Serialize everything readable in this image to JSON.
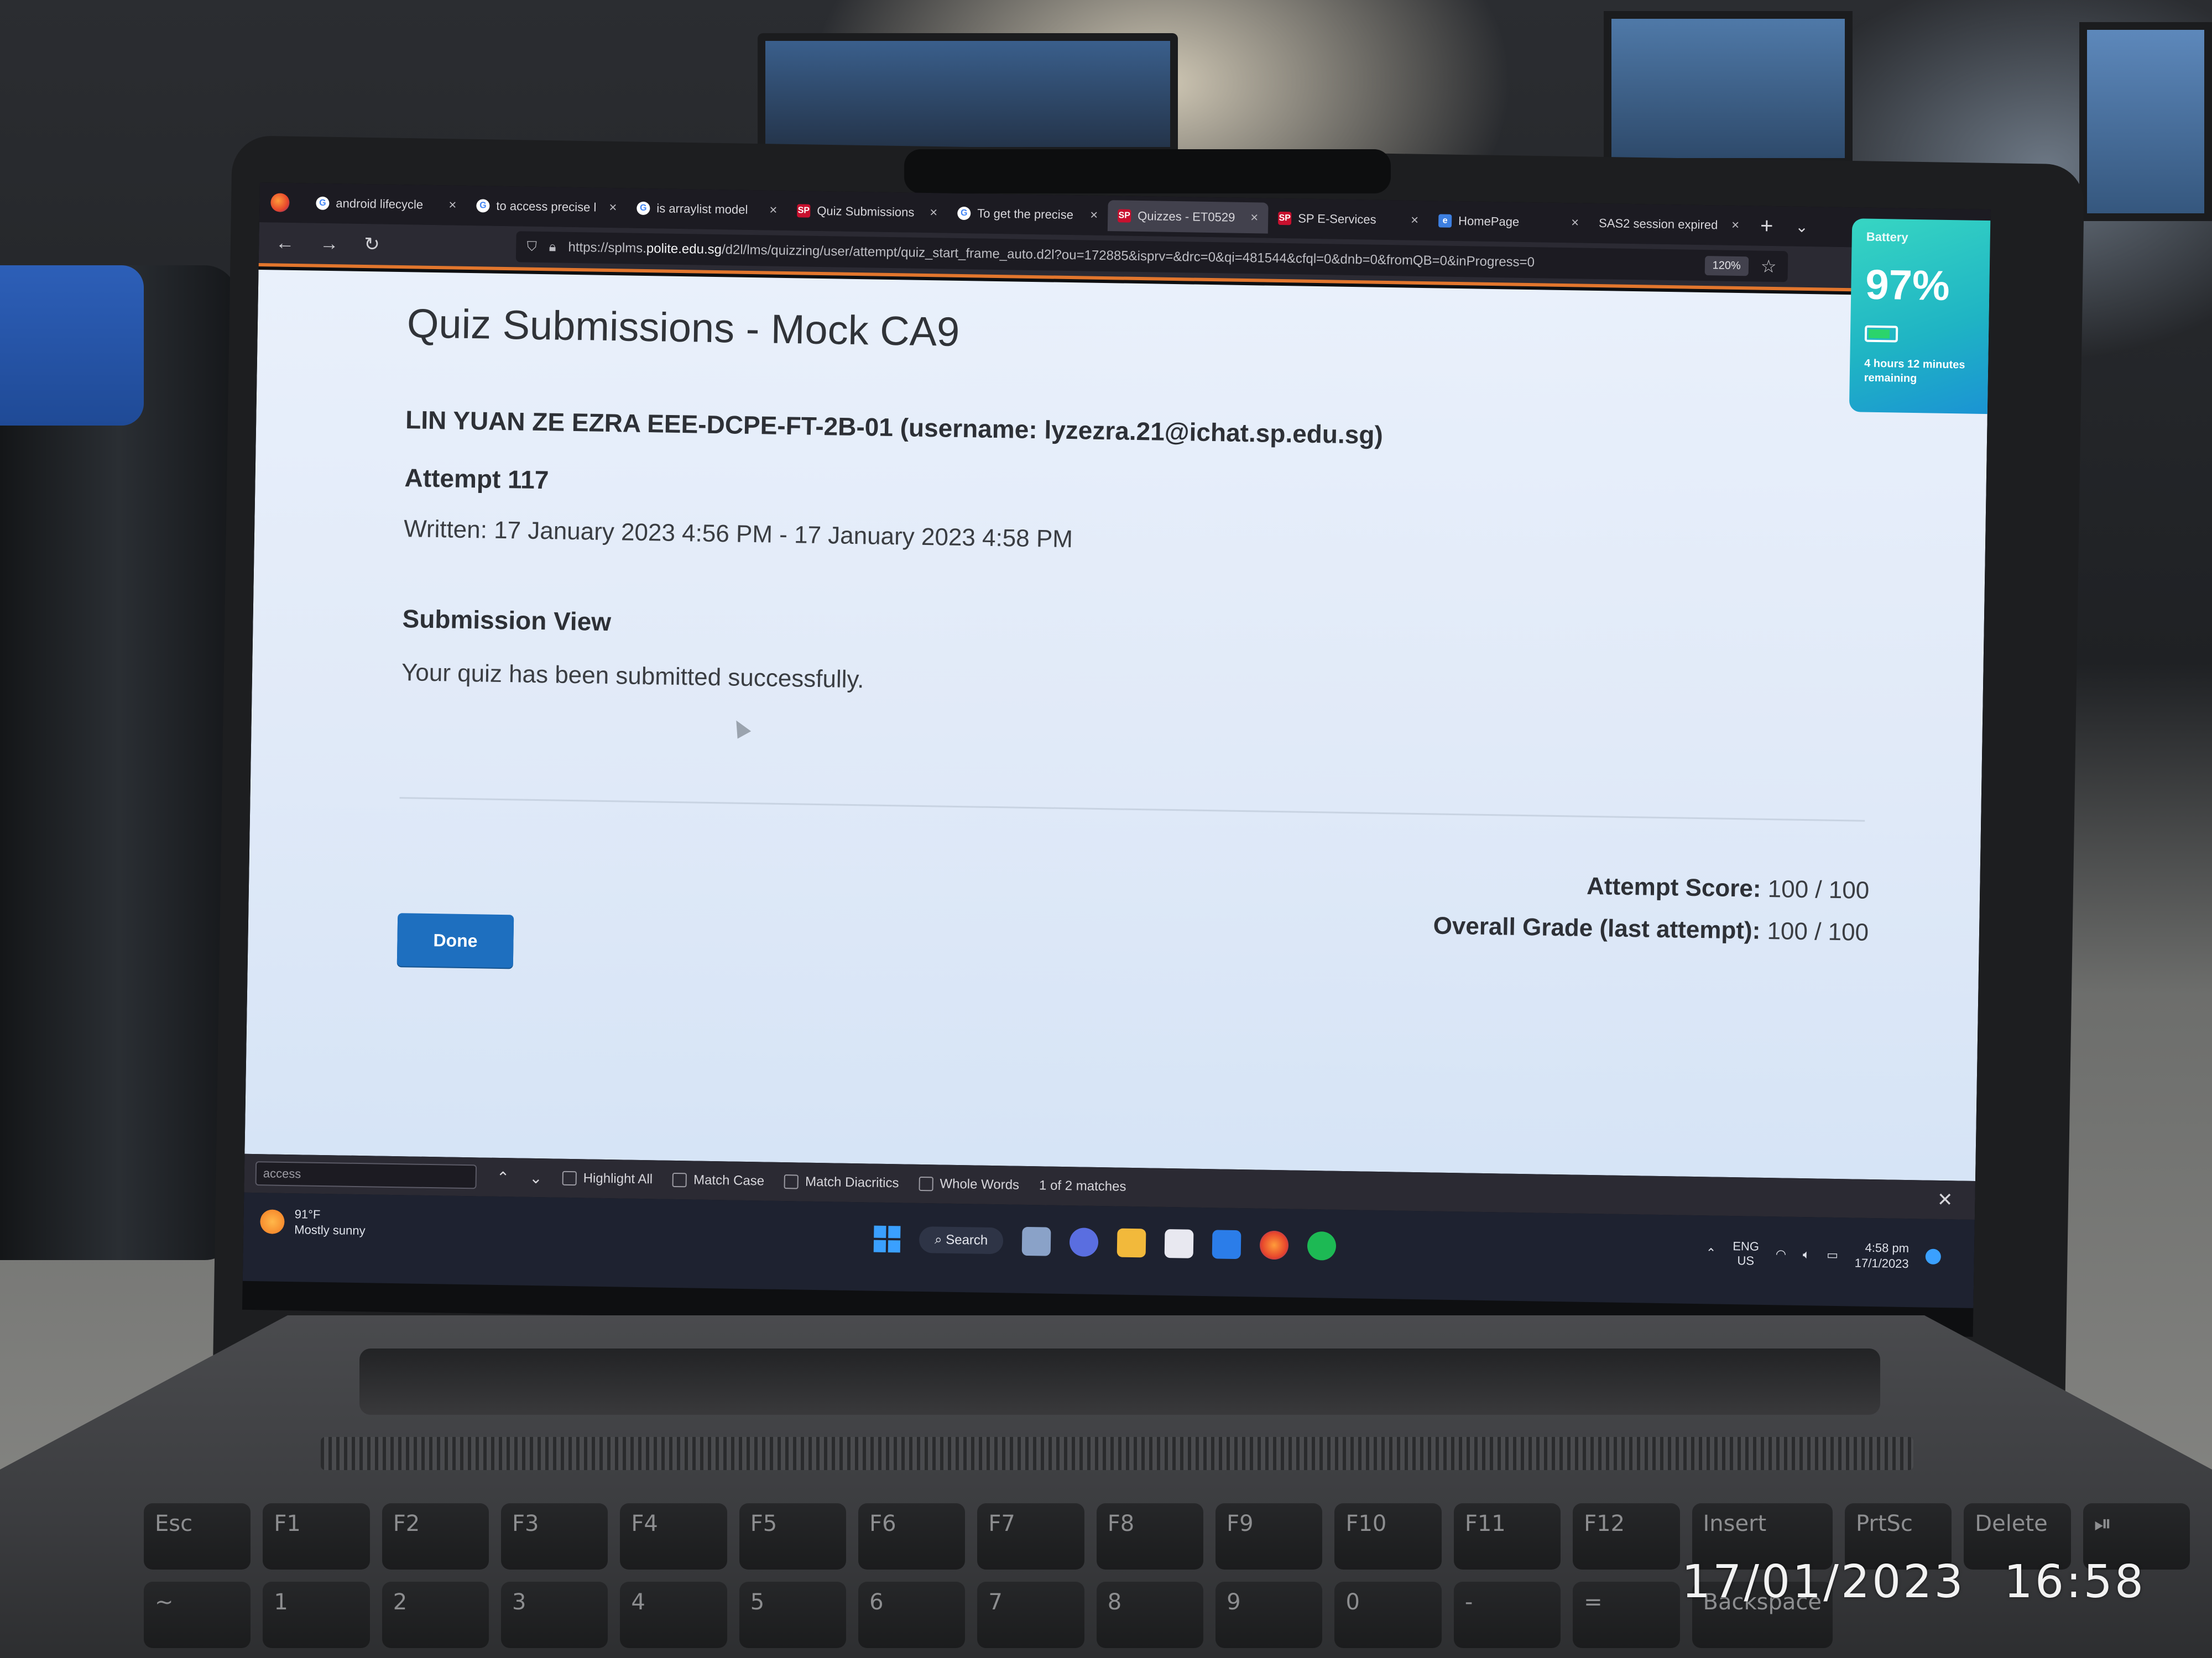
{
  "browser": {
    "tabs": [
      {
        "label": "android lifecycle",
        "favicon": "google-icon",
        "active": false
      },
      {
        "label": "to access precise l",
        "favicon": "google-icon",
        "active": false
      },
      {
        "label": "is arraylist model",
        "favicon": "google-icon",
        "active": false
      },
      {
        "label": "Quiz Submissions",
        "favicon": "sp-icon",
        "active": false
      },
      {
        "label": "To get the precise",
        "favicon": "google-icon",
        "active": false
      },
      {
        "label": "Quizzes - ET0529",
        "favicon": "sp-icon",
        "active": true
      },
      {
        "label": "SP E-Services",
        "favicon": "sp-icon",
        "active": false
      },
      {
        "label": "HomePage",
        "favicon": "ie-icon",
        "active": false
      },
      {
        "label": "SAS2 session expired",
        "favicon": "none",
        "active": false
      }
    ],
    "tab_close_glyph": "×",
    "new_tab_glyph": "+",
    "url_prefix": "https://splms.",
    "url_host": "polite.edu.sg",
    "url_path": "/d2l/lms/quizzing/user/attempt/quiz_start_frame_auto.d2l?ou=172885&isprv=&drc=0&qi=481544&cfql=0&dnb=0&fromQB=0&inProgress=0",
    "zoom": "120%",
    "accent_color": "#e2762d"
  },
  "page": {
    "title": "Quiz Submissions - Mock CA9",
    "student": "LIN YUAN ZE EZRA EEE-DCPE-FT-2B-01 (username: lyzezra.21@ichat.sp.edu.sg)",
    "attempt": "Attempt 117",
    "written": "Written: 17 January 2023 4:56 PM - 17 January 2023 4:58 PM",
    "submission_view_heading": "Submission View",
    "submission_message": "Your quiz has been submitted successfully.",
    "attempt_score_label": "Attempt Score:",
    "attempt_score_value": "100 / 100",
    "overall_grade_label": "Overall Grade (last attempt):",
    "overall_grade_value": "100 / 100",
    "done_label": "Done",
    "done_color": "#1e6fbf"
  },
  "findbar": {
    "query": "access",
    "options": [
      "Highlight All",
      "Match Case",
      "Match Diacritics",
      "Whole Words"
    ],
    "matches": "1 of 2 matches"
  },
  "taskbar": {
    "weather_temp": "91°F",
    "weather_desc": "Mostly sunny",
    "search_label": "Search",
    "lang_top": "ENG",
    "lang_bottom": "US",
    "clock_time": "4:58 pm",
    "clock_date": "17/1/2023"
  },
  "battery": {
    "title": "Battery",
    "percent": "97%",
    "remaining": "4 hours 12 minutes remaining"
  },
  "photo_timestamp": "17/01/2023 16:58",
  "keyboard": {
    "top_row": [
      "Esc",
      "F1",
      "F2",
      "F3",
      "F4",
      "F5",
      "F6",
      "F7",
      "F8",
      "F9",
      "F10",
      "F11",
      "F12",
      "Insert",
      "PrtSc",
      "Delete",
      "⏯"
    ],
    "number_row": [
      "~",
      "1",
      "2",
      "3",
      "4",
      "5",
      "6",
      "7",
      "8",
      "9",
      "0",
      "-",
      "=",
      "Backspace"
    ]
  }
}
